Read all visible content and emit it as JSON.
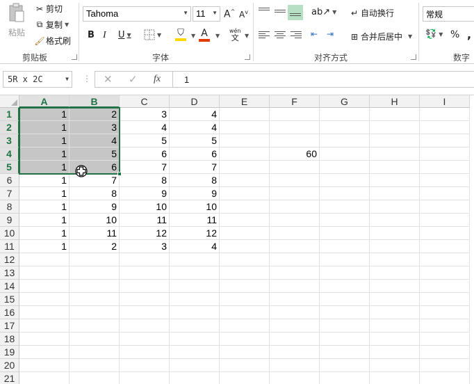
{
  "ribbon": {
    "clipboard": {
      "paste": "粘贴",
      "cut": "剪切",
      "copy": "复制",
      "format_painter": "格式刷",
      "group": "剪贴板"
    },
    "font": {
      "name": "Tahoma",
      "size": "11",
      "bold": "B",
      "italic": "I",
      "underline": "U",
      "phonetic": "wén",
      "phonetic_char": "文",
      "group": "字体"
    },
    "alignment": {
      "wrap": "自动换行",
      "merge": "合并后居中",
      "group": "对齐方式"
    },
    "number": {
      "format": "常规",
      "percent": "%",
      "comma": ",",
      "group": "数字"
    }
  },
  "formula_bar": {
    "name_box": "5R x 2C",
    "fx": "fx",
    "value": "1"
  },
  "columns": [
    "A",
    "B",
    "C",
    "D",
    "E",
    "F",
    "G",
    "H",
    "I"
  ],
  "rows": [
    "1",
    "2",
    "3",
    "4",
    "5",
    "6",
    "7",
    "8",
    "9",
    "10",
    "11",
    "12",
    "13",
    "14",
    "15",
    "16",
    "17",
    "18",
    "19",
    "20",
    "21"
  ],
  "cells": [
    [
      "1",
      "2",
      "3",
      "4",
      "",
      "",
      "",
      "",
      ""
    ],
    [
      "1",
      "3",
      "4",
      "4",
      "",
      "",
      "",
      "",
      ""
    ],
    [
      "1",
      "4",
      "5",
      "5",
      "",
      "",
      "",
      "",
      ""
    ],
    [
      "1",
      "5",
      "6",
      "6",
      "",
      "60",
      "",
      "",
      ""
    ],
    [
      "1",
      "6",
      "7",
      "7",
      "",
      "",
      "",
      "",
      ""
    ],
    [
      "1",
      "7",
      "8",
      "8",
      "",
      "",
      "",
      "",
      ""
    ],
    [
      "1",
      "8",
      "9",
      "9",
      "",
      "",
      "",
      "",
      ""
    ],
    [
      "1",
      "9",
      "10",
      "10",
      "",
      "",
      "",
      "",
      ""
    ],
    [
      "1",
      "10",
      "11",
      "11",
      "",
      "",
      "",
      "",
      ""
    ],
    [
      "1",
      "11",
      "12",
      "12",
      "",
      "",
      "",
      "",
      ""
    ],
    [
      "1",
      "2",
      "3",
      "4",
      "",
      "",
      "",
      "",
      ""
    ],
    [
      "",
      "",
      "",
      "",
      "",
      "",
      "",
      "",
      ""
    ],
    [
      "",
      "",
      "",
      "",
      "",
      "",
      "",
      "",
      ""
    ],
    [
      "",
      "",
      "",
      "",
      "",
      "",
      "",
      "",
      ""
    ],
    [
      "",
      "",
      "",
      "",
      "",
      "",
      "",
      "",
      ""
    ],
    [
      "",
      "",
      "",
      "",
      "",
      "",
      "",
      "",
      ""
    ],
    [
      "",
      "",
      "",
      "",
      "",
      "",
      "",
      "",
      ""
    ],
    [
      "",
      "",
      "",
      "",
      "",
      "",
      "",
      "",
      ""
    ],
    [
      "",
      "",
      "",
      "",
      "",
      "",
      "",
      "",
      ""
    ],
    [
      "",
      "",
      "",
      "",
      "",
      "",
      "",
      "",
      ""
    ],
    [
      "",
      "",
      "",
      "",
      "",
      "",
      "",
      "",
      ""
    ]
  ],
  "selection": {
    "columns": [
      "A",
      "B"
    ],
    "rows": [
      "1",
      "2",
      "3",
      "4",
      "5"
    ]
  },
  "colors": {
    "accent": "#217346",
    "selection_fill": "#c6c6c6",
    "header_bg": "#f2f2f2",
    "fill_color": "#ffd700",
    "font_color": "#e03c00"
  }
}
